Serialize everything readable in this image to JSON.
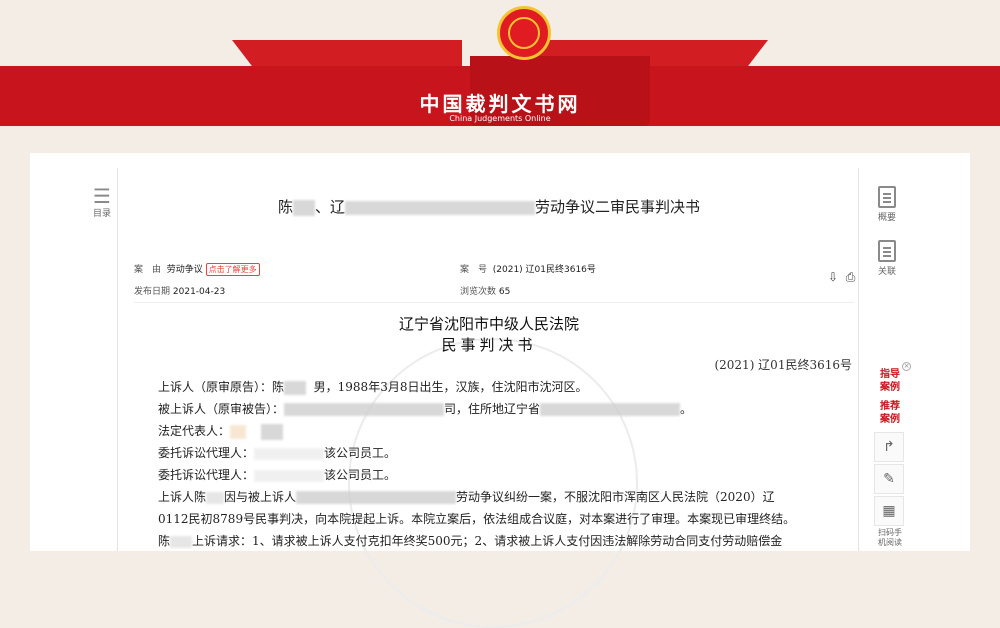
{
  "site": {
    "title": "中国裁判文书网",
    "subtitle": "China Judgements Online"
  },
  "left_toolbar": {
    "toc_label": "目录"
  },
  "right_toolbar": {
    "summary_label": "概要",
    "related_label": "关联"
  },
  "document": {
    "title_prefix": "陈",
    "title_mid": "、辽",
    "title_suffix": "劳动争议二审民事判决书",
    "meta": {
      "cause_label": "案　由",
      "cause_value": "劳动争议",
      "cause_tag": "点击了解更多",
      "case_label": "案　号",
      "case_value": "(2021) 辽01民终3616号",
      "publish_label": "发布日期",
      "publish_value": "2021-04-23",
      "views_label": "浏览次数",
      "views_value": "65"
    },
    "court": "辽宁省沈阳市中级人民法院",
    "doc_type": "民事判决书",
    "case_no": "(2021) 辽01民终3616号",
    "lines": [
      "上诉人（原审原告）：陈",
      "男，1988年3月8日出生，汉族，住沈阳市沈河区。",
      "被上诉人（原审被告）：",
      "司，住所地辽宁省",
      "法定代表人：",
      "委托诉讼代理人：",
      "该公司员工。",
      "委托诉讼代理人：",
      "该公司员工。",
      "上诉人陈",
      "因与被上诉人",
      "劳动争议纠纷一案，不服沈阳市浑南区人民法院（2020）辽",
      "0112民初8789号民事判决，向本院提起上诉。本院立案后，依法组成合议庭，对本案进行了审理。本案现已审理终结。",
      "陈",
      "上诉请求：1、请求被上诉人支付克扣年终奖500元；2、请求被上诉人支付因违法解除劳动合同支付劳动赔偿金"
    ]
  },
  "side_float": {
    "guide_label": "指导\n案例",
    "recommend_label": "推荐\n案例",
    "scan_label": "扫码手\n机阅读"
  }
}
